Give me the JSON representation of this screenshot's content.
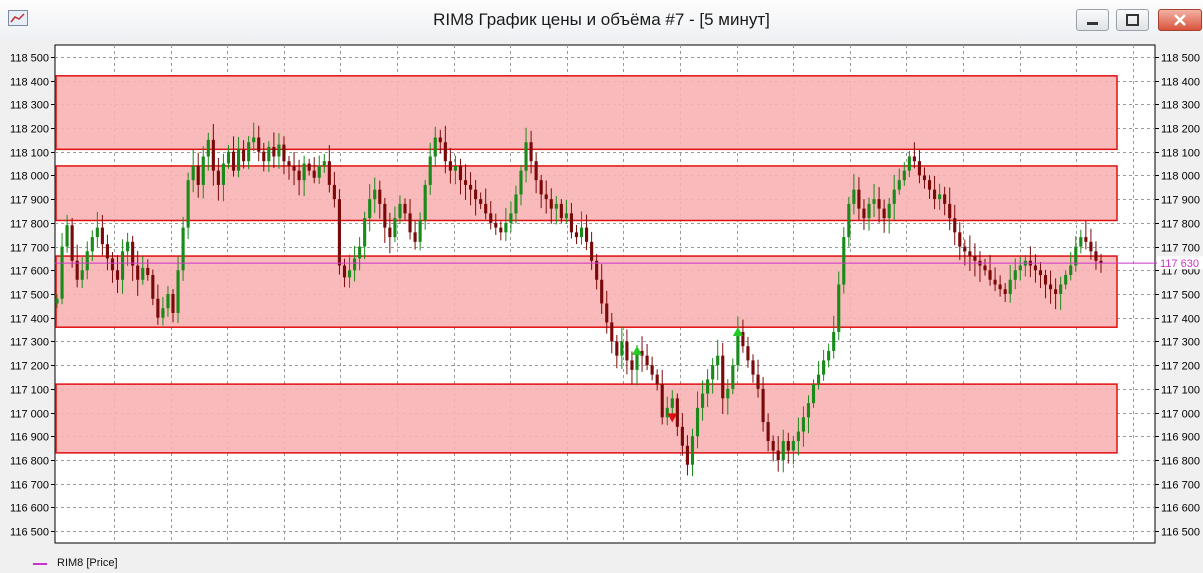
{
  "window": {
    "title": "RIM8 График цены и объёма #7 - [5 минут]"
  },
  "legend": {
    "label": "RIM8 [Price]",
    "color": "#cc33cc"
  },
  "colors": {
    "up": "#1a8a1a",
    "down": "#7a0a0a",
    "zone_fill": "#f7b3b3",
    "zone_border": "#e01010",
    "price_line": "#cc33cc"
  },
  "chart_data": {
    "type": "candlestick",
    "symbol": "RIM8",
    "timeframe": "5 минут",
    "ylim": [
      116450,
      118550
    ],
    "y_ticks": [
      "118 500",
      "118 400",
      "118 300",
      "118 200",
      "118 100",
      "118 000",
      "117 900",
      "117 800",
      "117 700",
      "117 600",
      "117 500",
      "117 400",
      "117 300",
      "117 200",
      "117 100",
      "117 000",
      "116 900",
      "116 800",
      "116 700",
      "116 600",
      "116 500"
    ],
    "last_price": 117630,
    "last_price_label": "117 630",
    "zones": [
      {
        "from": 118110,
        "to": 118420
      },
      {
        "from": 117810,
        "to": 118040
      },
      {
        "from": 117360,
        "to": 117660
      },
      {
        "from": 116830,
        "to": 117120
      }
    ],
    "markers": [
      {
        "type": "buy",
        "value": 117260,
        "index": 115
      },
      {
        "type": "sell",
        "value": 116980,
        "index": 122
      },
      {
        "type": "buy",
        "value": 117340,
        "index": 135
      }
    ],
    "closes": [
      117480,
      117700,
      117790,
      117640,
      117560,
      117600,
      117680,
      117740,
      117780,
      117710,
      117650,
      117600,
      117560,
      117680,
      117720,
      117620,
      117560,
      117610,
      117580,
      117480,
      117400,
      117440,
      117500,
      117420,
      117600,
      117780,
      117980,
      118040,
      117960,
      118080,
      118150,
      118020,
      117960,
      118050,
      118100,
      118020,
      118110,
      118060,
      118140,
      118160,
      118100,
      118060,
      118120,
      118080,
      118130,
      118060,
      118040,
      118020,
      117980,
      118050,
      118020,
      117990,
      118040,
      118060,
      117960,
      117900,
      117620,
      117570,
      117600,
      117650,
      117700,
      117820,
      117900,
      117940,
      117880,
      117780,
      117740,
      117820,
      117880,
      117840,
      117760,
      117720,
      117810,
      117960,
      118080,
      118160,
      118140,
      118060,
      118020,
      118040,
      117980,
      117960,
      117940,
      117900,
      117880,
      117840,
      117800,
      117780,
      117760,
      117800,
      117840,
      117920,
      118020,
      118140,
      118060,
      117980,
      117920,
      117900,
      117860,
      117880,
      117820,
      117840,
      117760,
      117740,
      117780,
      117720,
      117640,
      117560,
      117460,
      117380,
      117300,
      117240,
      117300,
      117220,
      117180,
      117260,
      117240,
      117200,
      117160,
      117120,
      116980,
      117020,
      117060,
      116940,
      116860,
      116780,
      116900,
      117020,
      117080,
      117140,
      117200,
      117240,
      117060,
      117100,
      117200,
      117340,
      117280,
      117220,
      117160,
      117100,
      116960,
      116880,
      116840,
      116800,
      116880,
      116840,
      116880,
      116920,
      116980,
      117040,
      117120,
      117160,
      117220,
      117260,
      117340,
      117540,
      117740,
      117880,
      117940,
      117860,
      117820,
      117880,
      117900,
      117860,
      117820,
      117880,
      117940,
      117980,
      118020,
      118080,
      118060,
      118000,
      117980,
      117940,
      117900,
      117920,
      117880,
      117820,
      117760,
      117700,
      117680,
      117660,
      117640,
      117620,
      117600,
      117560,
      117540,
      117520,
      117500,
      117560,
      117600,
      117620,
      117640,
      117620,
      117600,
      117580,
      117540,
      117520,
      117500,
      117540,
      117580,
      117620,
      117700,
      117740,
      117720,
      117680,
      117640,
      117630
    ]
  }
}
